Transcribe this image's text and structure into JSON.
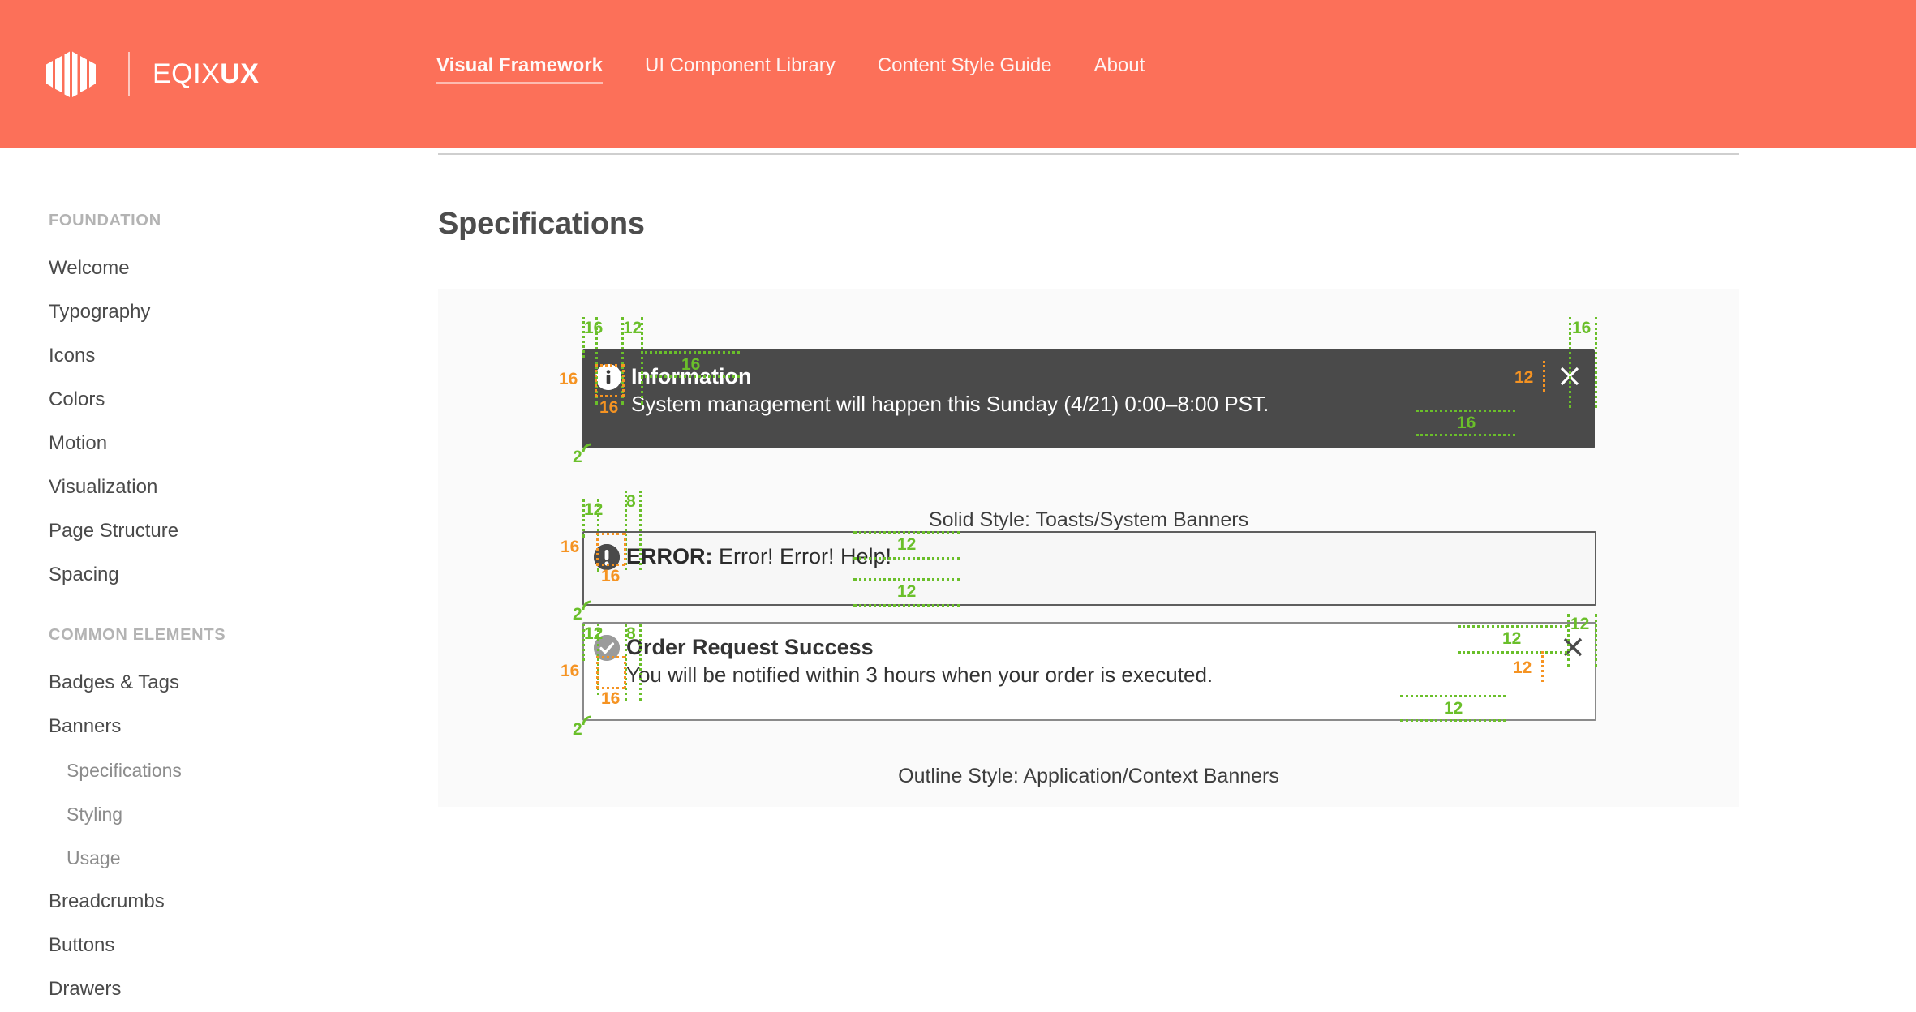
{
  "header": {
    "brand_name_light": "EQIX",
    "brand_name_bold": "UX",
    "logo_icon": "eqix-hexagon-logo",
    "accent_color": "#fc7059",
    "nav": [
      {
        "label": "Visual Framework",
        "active": true
      },
      {
        "label": "UI Component Library",
        "active": false
      },
      {
        "label": "Content Style Guide",
        "active": false
      },
      {
        "label": "About",
        "active": false
      }
    ]
  },
  "sidebar": {
    "groups": [
      {
        "title": "FOUNDATION",
        "items": [
          {
            "label": "Welcome",
            "level": 1,
            "selected": false
          },
          {
            "label": "Typography",
            "level": 1,
            "selected": false
          },
          {
            "label": "Icons",
            "level": 1,
            "selected": false
          },
          {
            "label": "Colors",
            "level": 1,
            "selected": false
          },
          {
            "label": "Motion",
            "level": 1,
            "selected": false
          },
          {
            "label": "Visualization",
            "level": 1,
            "selected": false
          },
          {
            "label": "Page Structure",
            "level": 1,
            "selected": false
          },
          {
            "label": "Spacing",
            "level": 1,
            "selected": false
          }
        ]
      },
      {
        "title": "COMMON ELEMENTS",
        "items": [
          {
            "label": "Badges & Tags",
            "level": 1,
            "selected": false
          },
          {
            "label": "Banners",
            "level": 1,
            "selected": false
          },
          {
            "label": "Specifications",
            "level": 2,
            "selected": true
          },
          {
            "label": "Styling",
            "level": 2,
            "selected": false
          },
          {
            "label": "Usage",
            "level": 2,
            "selected": false
          },
          {
            "label": "Breadcrumbs",
            "level": 1,
            "selected": false
          },
          {
            "label": "Buttons",
            "level": 1,
            "selected": false
          },
          {
            "label": "Drawers",
            "level": 1,
            "selected": false
          }
        ]
      }
    ]
  },
  "main": {
    "page_title": "Specifications",
    "caption_solid": "Solid Style: Toasts/System Banners",
    "caption_outline": "Outline Style: Application/Context Banners",
    "banners": {
      "info": {
        "icon": "info-circle-icon",
        "title": "Information",
        "text": "System management will happen this Sunday (4/21) 0:00–8:00 PST.",
        "close_icon": "close-icon",
        "background": "#4a4a4a",
        "style": "solid"
      },
      "error": {
        "icon": "alert-exclamation-icon",
        "label_bold": "ERROR:",
        "label_rest": " Error! Error! Help!",
        "background": "#f7f7f7",
        "border": "#5e5e5e",
        "style": "outline"
      },
      "success": {
        "icon": "check-circle-icon",
        "title": "Order Request Success",
        "text": "You will be notified within 3 hours when your order is executed.",
        "close_icon": "close-icon",
        "background": "#ffffff",
        "border": "#8a8a8a",
        "style": "outline"
      }
    },
    "annotations": {
      "green_color": "#6abf2a",
      "orange_color": "#f59322",
      "info": {
        "pad_left": "16",
        "icon_gap": "12",
        "pad_top": "16",
        "icon_w": "16",
        "icon_h": "16",
        "pad_right": "16",
        "close_gap": "12",
        "pad_bottom": "16",
        "radius": "2"
      },
      "error": {
        "pad_left": "12",
        "icon_gap": "8",
        "icon_w": "16",
        "icon_h": "16",
        "pad_top": "12",
        "pad_bottom": "12",
        "radius": "2"
      },
      "success": {
        "pad_left": "12",
        "icon_gap": "8",
        "icon_w": "16",
        "icon_h": "16",
        "pad_top": "12",
        "pad_right": "12",
        "close_gap": "12",
        "pad_bottom": "12",
        "radius": "2"
      }
    }
  }
}
